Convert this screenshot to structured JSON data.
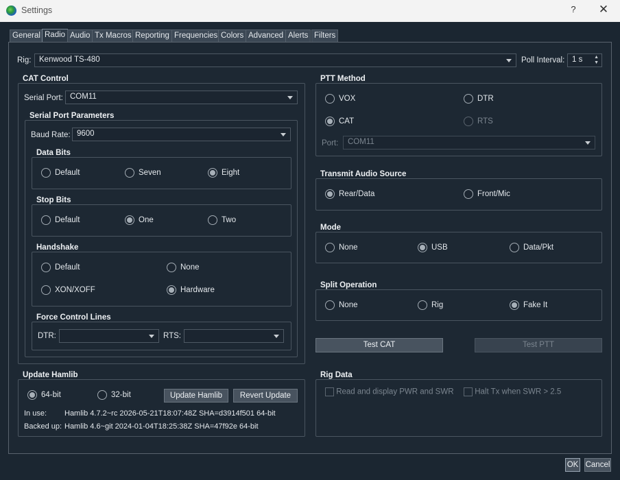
{
  "window": {
    "title": "Settings",
    "help": "?",
    "close": "✕"
  },
  "tabs": [
    "General",
    "Radio",
    "Audio",
    "Tx Macros",
    "Reporting",
    "Frequencies",
    "Colors",
    "Advanced",
    "Alerts",
    "Filters"
  ],
  "rig": {
    "label": "Rig:",
    "value": "Kenwood TS-480",
    "poll_label": "Poll Interval:",
    "poll_value": "1 s"
  },
  "cat": {
    "title": "CAT Control",
    "serial_port_label": "Serial Port:",
    "serial_port_value": "COM11",
    "params_title": "Serial Port Parameters",
    "baud_label": "Baud Rate:",
    "baud_value": "9600",
    "data_bits": {
      "title": "Data Bits",
      "options": [
        "Default",
        "Seven",
        "Eight"
      ],
      "selected": "Eight"
    },
    "stop_bits": {
      "title": "Stop Bits",
      "options": [
        "Default",
        "One",
        "Two"
      ],
      "selected": "One"
    },
    "handshake": {
      "title": "Handshake",
      "options": [
        "Default",
        "None",
        "XON/XOFF",
        "Hardware"
      ],
      "selected": "Hardware"
    },
    "force": {
      "title": "Force Control Lines",
      "dtr_label": "DTR:",
      "dtr_value": "",
      "rts_label": "RTS:",
      "rts_value": ""
    }
  },
  "ptt": {
    "title": "PTT Method",
    "options": [
      "VOX",
      "DTR",
      "CAT",
      "RTS"
    ],
    "selected": "CAT",
    "port_label": "Port:",
    "port_value": "COM11"
  },
  "audio_source": {
    "title": "Transmit Audio Source",
    "options": [
      "Rear/Data",
      "Front/Mic"
    ],
    "selected": "Rear/Data"
  },
  "mode": {
    "title": "Mode",
    "options": [
      "None",
      "USB",
      "Data/Pkt"
    ],
    "selected": "USB"
  },
  "split": {
    "title": "Split Operation",
    "options": [
      "None",
      "Rig",
      "Fake It"
    ],
    "selected": "Fake It"
  },
  "buttons": {
    "test_cat": "Test CAT",
    "test_ptt": "Test PTT",
    "ok": "OK",
    "cancel": "Cancel"
  },
  "hamlib": {
    "title": "Update Hamlib",
    "options": [
      "64-bit",
      "32-bit"
    ],
    "selected": "64-bit",
    "update_button": "Update Hamlib",
    "revert_button": "Revert Update",
    "in_use_label": "In use:",
    "in_use_value": "Hamlib 4.7.2~rc 2026-05-21T18:07:48Z SHA=d3914f501 64-bit",
    "backed_label": "Backed up:",
    "backed_value": "Hamlib 4.6~git 2024-01-04T18:25:38Z SHA=47f92e 64-bit"
  },
  "rig_data": {
    "title": "Rig Data",
    "read_pwr": "Read and display PWR and SWR",
    "halt_tx": "Halt Tx when SWR > 2.5"
  }
}
